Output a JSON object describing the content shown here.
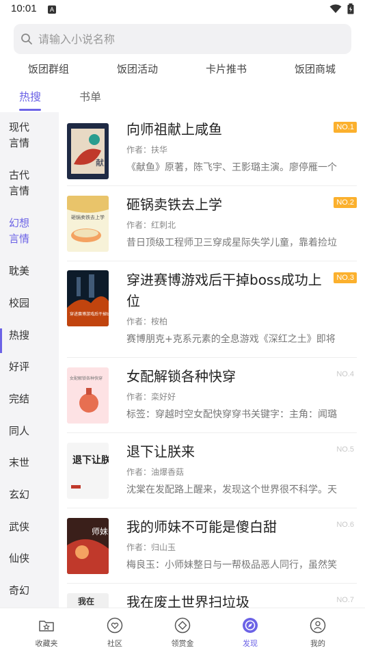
{
  "status_bar": {
    "time": "10:01",
    "notification_letter": "A"
  },
  "search": {
    "placeholder": "请输入小说名称"
  },
  "quick_links": [
    "饭团群组",
    "饭团活动",
    "卡片推书",
    "饭团商城"
  ],
  "tabs": [
    {
      "label": "热搜",
      "active": true
    },
    {
      "label": "书单",
      "active": false
    }
  ],
  "sidebar": {
    "items": [
      "现代言情",
      "古代言情",
      "幻想言情",
      "耽美",
      "校园",
      "热搜",
      "好评",
      "完结",
      "同人",
      "末世",
      "玄幻",
      "武侠",
      "仙侠",
      "奇幻"
    ],
    "active_index": 2
  },
  "books": [
    {
      "title": "向师祖献上咸鱼",
      "author": "作者：扶华",
      "desc": "《献鱼》原著，陈飞宇、王影璐主演。廖停雁一个",
      "rank": "NO.1",
      "hot": true,
      "cover_text": "献鱼",
      "cover_colors": [
        "#1f2a44",
        "#c0392b"
      ]
    },
    {
      "title": "砸锅卖铁去上学",
      "author": "作者：红刺北",
      "desc": "昔日顶级工程师卫三穿成星际失学儿童，靠着捡垃",
      "rank": "NO.2",
      "hot": true,
      "cover_text": "砸锅卖铁去上学",
      "cover_colors": [
        "#f7f2d8",
        "#e9c46a"
      ]
    },
    {
      "title": "穿进赛博游戏后干掉boss成功上位",
      "author": "作者：桉柏",
      "desc": "赛博朋克+克系元素的全息游戏《深红之土》即将",
      "rank": "NO.3",
      "hot": true,
      "cover_text": "穿进赛博游戏后干掉boss成功上位",
      "cover_colors": [
        "#0d1b2a",
        "#c1440e"
      ]
    },
    {
      "title": "女配解锁各种快穿",
      "author": "作者：栾好好",
      "desc": "标签：穿越时空女配快穿穿书关键字：主角：闻璐",
      "rank": "NO.4",
      "hot": false,
      "cover_text": "女配解锁各种快穿",
      "cover_colors": [
        "#fde2e4",
        "#e76f51"
      ]
    },
    {
      "title": "退下让朕来",
      "author": "作者：油爆香菇",
      "desc": "沈棠在发配路上醒来，发现这个世界很不科学。天",
      "rank": "NO.5",
      "hot": false,
      "cover_text": "退下让朕来",
      "cover_colors": [
        "#f5f5f5",
        "#222222"
      ]
    },
    {
      "title": "我的师妹不可能是傻白甜",
      "author": "作者：归山玉",
      "desc": "梅良玉：小师妹整日与一帮极品恶人同行，虽然笑",
      "rank": "NO.6",
      "hot": false,
      "cover_text": "师妹",
      "cover_colors": [
        "#3a1f1a",
        "#c0392b"
      ]
    },
    {
      "title": "我在废土世界扫垃圾",
      "author": "",
      "desc": "",
      "rank": "NO.7",
      "hot": false,
      "cover_text": "我在",
      "cover_colors": [
        "#f0f0f0",
        "#333333"
      ]
    }
  ],
  "bottom_nav": [
    {
      "label": "收藏夹",
      "icon": "folder-star-icon",
      "active": false
    },
    {
      "label": "社区",
      "icon": "community-heart-icon",
      "active": false
    },
    {
      "label": "领赏金",
      "icon": "reward-diamond-icon",
      "active": false
    },
    {
      "label": "发现",
      "icon": "discover-compass-icon",
      "active": true
    },
    {
      "label": "我的",
      "icon": "profile-person-icon",
      "active": false
    }
  ],
  "colors": {
    "accent": "#6c63e6",
    "rank_hot": "#fbb02d",
    "sidebar_bg": "#f4f4f6"
  }
}
